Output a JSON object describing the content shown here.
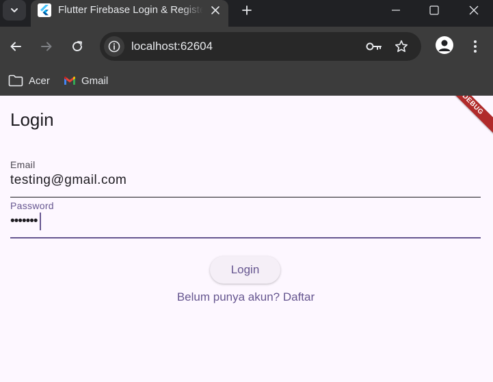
{
  "browser": {
    "tab": {
      "title": "Flutter Firebase Login & Register"
    },
    "address_bar": {
      "url": "localhost:62604"
    },
    "bookmarks": [
      {
        "label": "Acer",
        "icon": "folder-icon"
      },
      {
        "label": "Gmail",
        "icon": "gmail-icon"
      }
    ]
  },
  "app": {
    "title": "Login",
    "debug_banner": "DEBUG",
    "email": {
      "label": "Email",
      "value": "testing@gmail.com"
    },
    "password": {
      "label": "Password",
      "masked_value": "•••••••"
    },
    "login_button": "Login",
    "register_link": "Belum punya akun? Daftar"
  },
  "colors": {
    "chrome_dark": "#202124",
    "chrome": "#3c3c3c",
    "page_background": "#fdf7ff",
    "accent": "#65558f",
    "debug_banner": "#b02a2a"
  }
}
